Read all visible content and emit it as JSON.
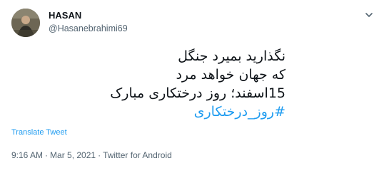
{
  "user": {
    "display_name": "HASAN",
    "handle": "@Hasanebrahimi69"
  },
  "icons": {
    "more": "chevron-down-icon",
    "avatar": "avatar-photo"
  },
  "tweet": {
    "lines": [
      "نگذارید بمیرد جنگل",
      "که جهان خواهد مرد",
      "15اسفند؛ روز درختکاری مبارک"
    ],
    "hashtag": "#روز_درختکاری"
  },
  "translate_label": "Translate Tweet",
  "meta": {
    "time": "9:16 AM",
    "separator": "·",
    "date": "Mar 5, 2021",
    "source": "Twitter for Android"
  },
  "colors": {
    "link": "#1d9bf0",
    "secondary_text": "#536471",
    "primary_text": "#0f1419"
  }
}
